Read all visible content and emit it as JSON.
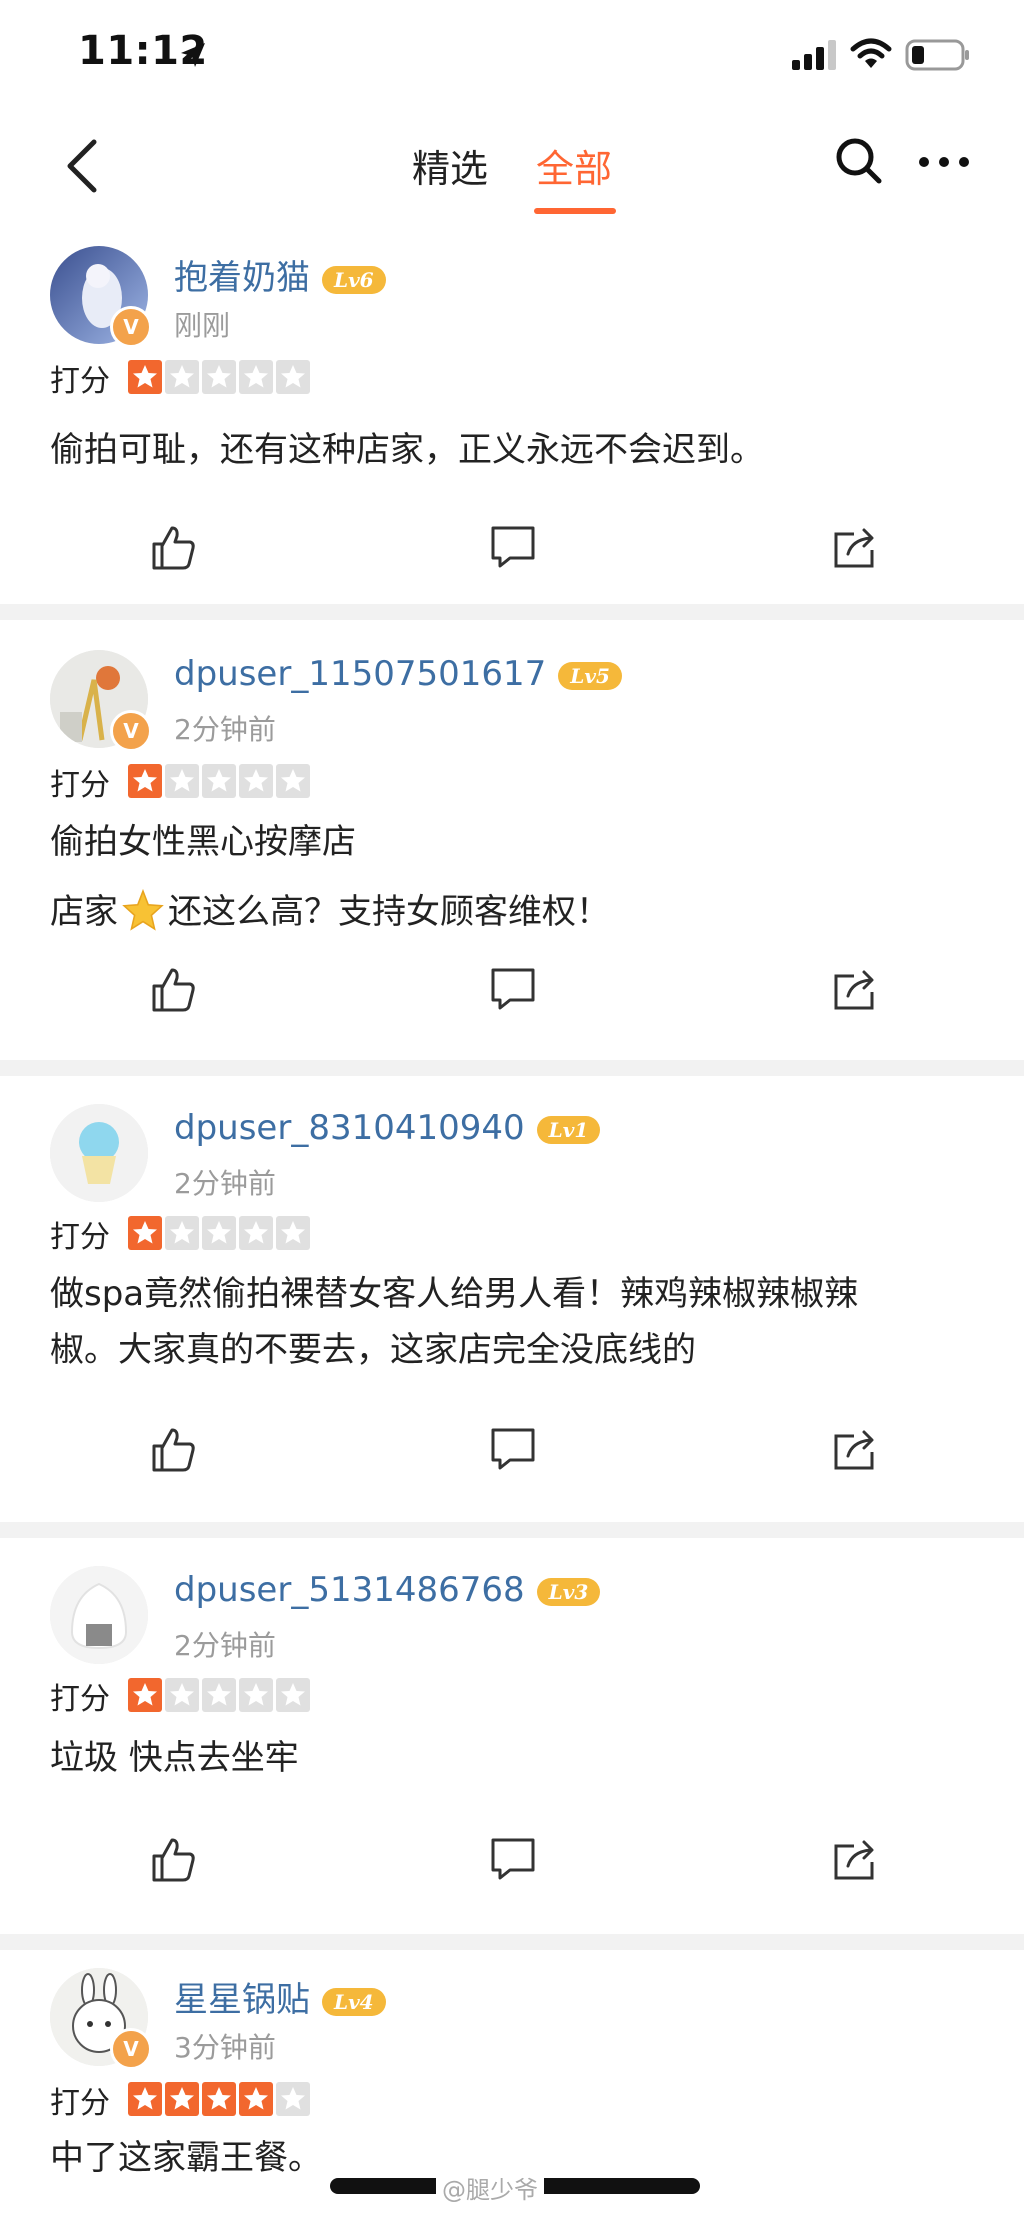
{
  "status": {
    "time": "11:12"
  },
  "nav": {
    "tabs": [
      {
        "label": "精选"
      },
      {
        "label": "全部"
      }
    ],
    "active_tab": "全部",
    "accent": "#ff6633"
  },
  "rating_label": "打分",
  "reviews": [
    {
      "user": "抱着奶猫",
      "level": "Lv6",
      "time": "刚刚",
      "stars": 1,
      "verified": true,
      "lines": [
        "偷拍可耻，还有这种店家，正义永远不会迟到。"
      ]
    },
    {
      "user": "dpuser_11507501617",
      "level": "Lv5",
      "time": "2分钟前",
      "stars": 1,
      "verified": true,
      "lines": [
        "偷拍女性黑心按摩店",
        "店家",
        "还这么高？支持女顾客维权！"
      ]
    },
    {
      "user": "dpuser_8310410940",
      "level": "Lv1",
      "time": "2分钟前",
      "stars": 1,
      "verified": false,
      "lines": [
        "做spa竟然偷拍裸替女客人给男人看！辣鸡辣椒辣椒辣",
        "椒。大家真的不要去，这家店完全没底线的"
      ]
    },
    {
      "user": "dpuser_5131486768",
      "level": "Lv3",
      "time": "2分钟前",
      "stars": 1,
      "verified": false,
      "lines": [
        "垃圾 快点去坐牢"
      ]
    },
    {
      "user": "星星锅贴",
      "level": "Lv4",
      "time": "3分钟前",
      "stars": 4,
      "verified": true,
      "lines": [
        "中了这家霸王餐。"
      ]
    }
  ],
  "watermark": "@腿少爷",
  "colors": {
    "star_on": "#f2672e",
    "star_off": "#e0e0e0",
    "username": "#3d6ea3",
    "level_badge": "#f5b83a"
  }
}
